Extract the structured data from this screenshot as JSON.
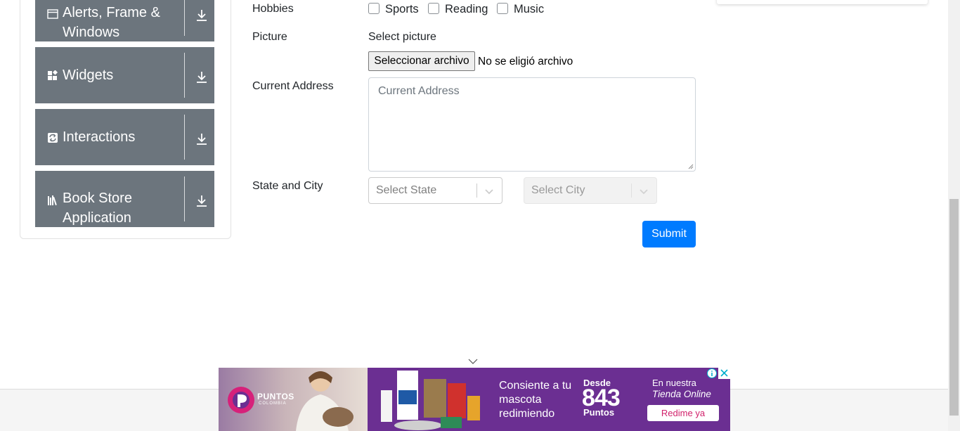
{
  "sidebar": {
    "groups": [
      {
        "label": "Alerts, Frame & Windows",
        "icon": "window-icon"
      },
      {
        "label": "Widgets",
        "icon": "widgets-icon"
      },
      {
        "label": "Interactions",
        "icon": "interactions-icon"
      },
      {
        "label": "Book Store Application",
        "icon": "book-store-icon"
      }
    ]
  },
  "form": {
    "hobbies": {
      "label": "Hobbies",
      "options": [
        "Sports",
        "Reading",
        "Music"
      ],
      "checked": [
        false,
        false,
        false
      ]
    },
    "picture": {
      "label": "Picture",
      "select_label": "Select picture",
      "button_label": "Seleccionar archivo",
      "status": "No se eligió archivo"
    },
    "current_address": {
      "label": "Current Address",
      "placeholder": "Current Address",
      "value": ""
    },
    "state_city": {
      "label": "State and City",
      "state_placeholder": "Select State",
      "city_placeholder": "Select City",
      "city_disabled": true
    },
    "submit_label": "Submit"
  },
  "ad": {
    "brand": "PUNTOS",
    "brand_sub": "COLOMBIA",
    "message": "Consiente a tu mascota redimiendo",
    "desde": "Desde",
    "points_value": "843",
    "points_label": "Puntos",
    "store_line1": "En nuestra",
    "store_line2": "Tienda Online",
    "cta": "Redime ya",
    "colors": {
      "background": "#6b2f92",
      "cta_text": "#d1216b"
    }
  },
  "colors": {
    "sidebar_group": "#6c757d",
    "primary": "#007bff"
  }
}
